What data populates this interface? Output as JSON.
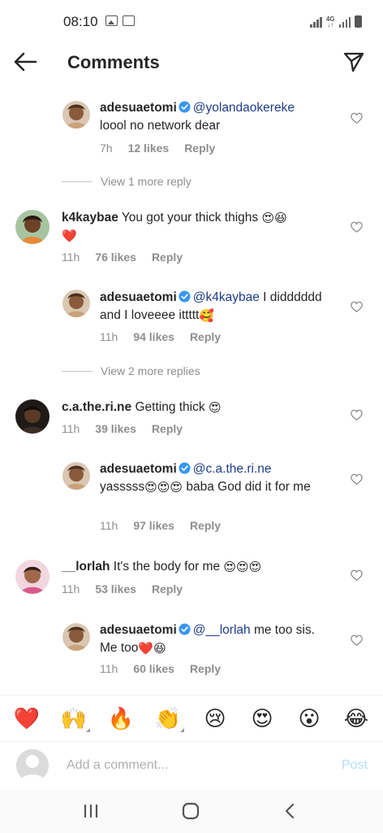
{
  "status_bar": {
    "time": "08:10",
    "network": "4G"
  },
  "header": {
    "title": "Comments"
  },
  "comments": [
    {
      "user": "adesuaetomi",
      "verified": true,
      "mention": "@yolandaokereke",
      "text": "loool no network dear",
      "time": "7h",
      "likes": "12 likes",
      "reply": "Reply"
    },
    {
      "user": "k4kaybae",
      "text": "You got your thick thighs ",
      "time": "11h",
      "likes": "76 likes",
      "reply": "Reply"
    },
    {
      "user": "adesuaetomi",
      "verified": true,
      "mention": "@k4kaybae",
      "text": " I didddddd and I loveeee  ittttt",
      "time": "11h",
      "likes": "94 likes",
      "reply": "Reply"
    },
    {
      "user": "c.a.the.ri.ne",
      "text": "Getting thick ",
      "time": "11h",
      "likes": "39 likes",
      "reply": "Reply"
    },
    {
      "user": "adesuaetomi",
      "verified": true,
      "mention": "@c.a.the.ri.ne",
      "text": " baba God did it for me",
      "text_prefix": "yasssss",
      "time": "11h",
      "likes": "97 likes",
      "reply": "Reply"
    },
    {
      "user": "__lorlah",
      "text": "It's the body for me ",
      "time": "11h",
      "likes": "53 likes",
      "reply": "Reply"
    },
    {
      "user": "adesuaetomi",
      "verified": true,
      "mention": "@__lorlah",
      "text": " me too sis. Me too",
      "time": "11h",
      "likes": "60 likes",
      "reply": "Reply"
    }
  ],
  "view_more": [
    {
      "label": "View 1 more reply"
    },
    {
      "label": "View 2 more replies"
    }
  ],
  "emoji_bar": [
    "❤️",
    "🙌",
    "🔥",
    "👏",
    "😢",
    "😍",
    "😮",
    "😂"
  ],
  "add_comment": {
    "placeholder": "Add a comment...",
    "post_label": "Post"
  },
  "colors": {
    "mention": "#1f3c88",
    "verified": "#3897f0",
    "post_disabled": "#b2dffc",
    "heart_red": "#ed4956"
  }
}
